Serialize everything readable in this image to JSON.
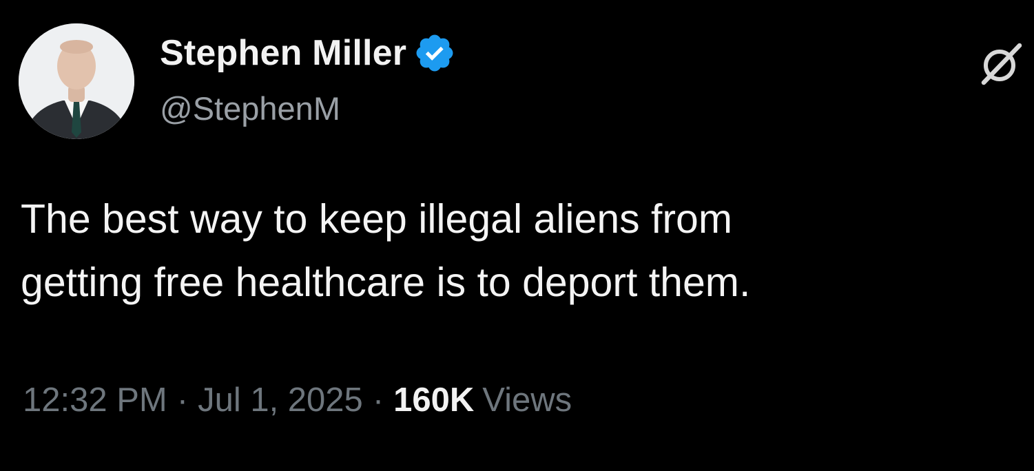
{
  "author": {
    "display_name": "Stephen Miller",
    "handle": "@StephenM",
    "verified": true,
    "verified_color": "#1d9bf0",
    "avatar_icon": "profile-photo"
  },
  "header": {
    "grok_icon": "grok-icon"
  },
  "tweet": {
    "text": "The best way to keep illegal aliens from\ngetting free healthcare is to deport them."
  },
  "meta": {
    "time": "12:32 PM",
    "separator": "·",
    "date": "Jul 1, 2025",
    "views_count": "160K",
    "views_label": "Views"
  },
  "colors": {
    "background": "#000000",
    "text": "#e7e9ea",
    "secondary": "#6e767d"
  }
}
